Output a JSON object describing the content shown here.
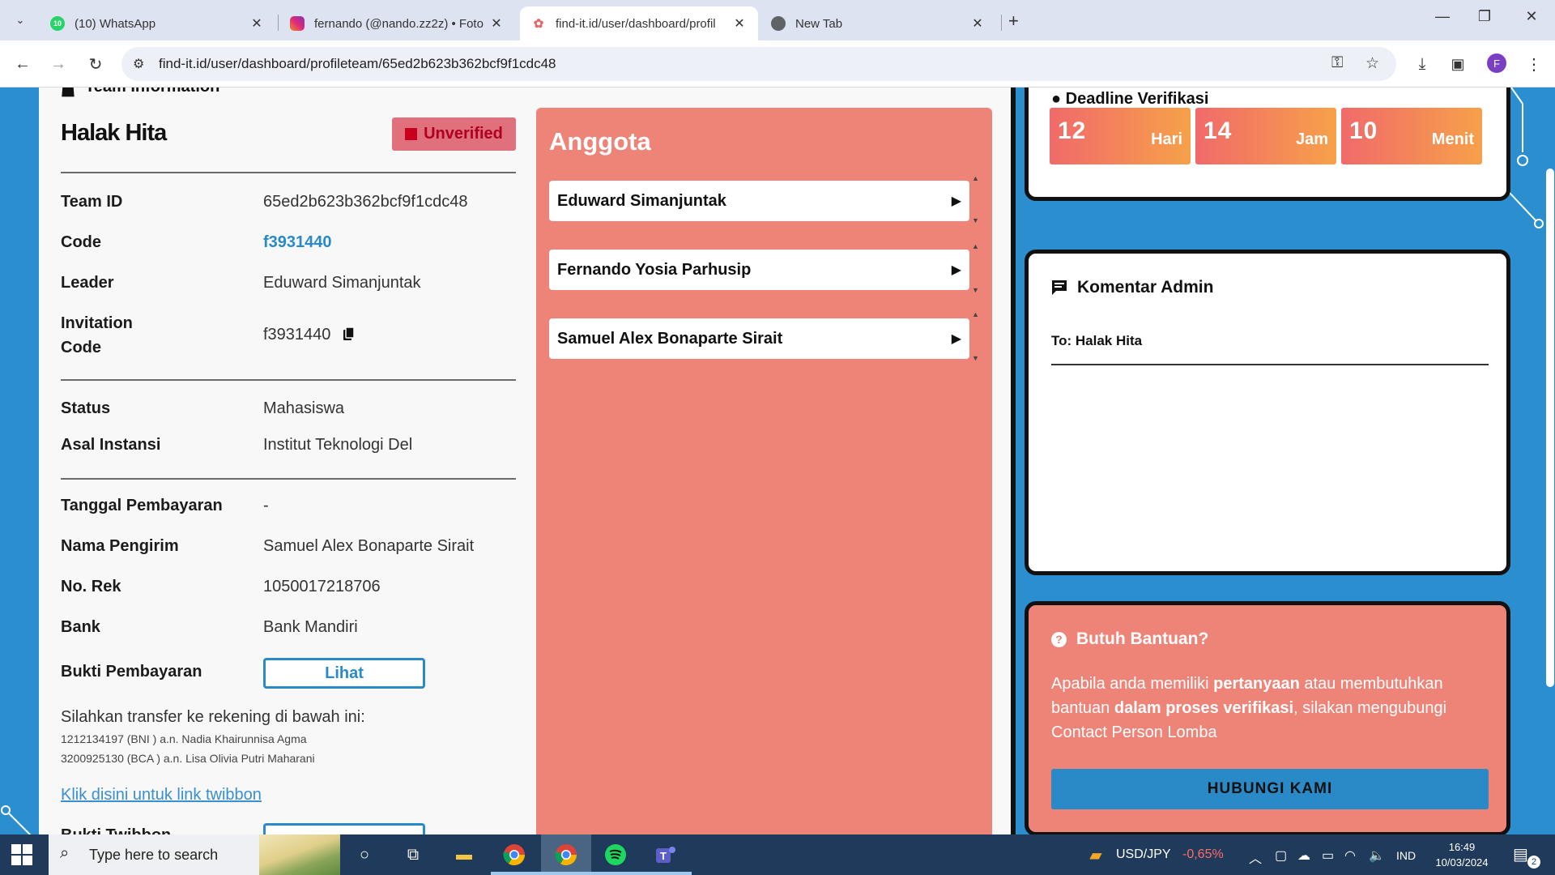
{
  "browser": {
    "tabs": [
      {
        "title": "(10) WhatsApp",
        "badge": "10"
      },
      {
        "title": "fernando (@nando.zz2z) • Foto"
      },
      {
        "title": "find-it.id/user/dashboard/profil"
      },
      {
        "title": "New Tab"
      }
    ],
    "url": "find-it.id/user/dashboard/profileteam/65ed2b623b362bcf9f1cdc48",
    "profile_initial": "F"
  },
  "team": {
    "section_title": "Team Information",
    "name": "Halak Hita",
    "status_badge": "Unverified",
    "fields": {
      "team_id_label": "Team ID",
      "team_id": "65ed2b623b362bcf9f1cdc48",
      "code_label": "Code",
      "code": "f3931440",
      "leader_label": "Leader",
      "leader": "Eduward Simanjuntak",
      "invitation_label_1": "Invitation",
      "invitation_label_2": "Code",
      "invitation_code": "f3931440",
      "status_label": "Status",
      "status": "Mahasiswa",
      "asal_label": "Asal Instansi",
      "asal": "Institut Teknologi Del",
      "tanggal_label": "Tanggal Pembayaran",
      "tanggal": "-",
      "pengirim_label": "Nama Pengirim",
      "pengirim": "Samuel Alex Bonaparte Sirait",
      "rek_label": "No. Rek",
      "rek": "1050017218706",
      "bank_label": "Bank",
      "bank": "Bank Mandiri",
      "bukti_label": "Bukti Pembayaran",
      "bukti_button": "Lihat",
      "bukti_twibbon_label": "Bukti Twibbon"
    },
    "transfer_text": "Silahkan transfer ke rekening di bawah ini:",
    "accounts": [
      "1212134197 (BNI ) a.n. Nadia Khairunnisa Agma",
      "3200925130 (BCA ) a.n. Lisa Olivia Putri Maharani"
    ],
    "twibbon_link": "Klik disini untuk link twibbon"
  },
  "anggota": {
    "title": "Anggota",
    "members": [
      "Eduward Simanjuntak",
      "Fernando Yosia Parhusip",
      "Samuel Alex Bonaparte Sirait"
    ]
  },
  "deadline": {
    "title": "Deadline Verifikasi",
    "boxes": [
      {
        "num": "12",
        "unit": "Hari"
      },
      {
        "num": "14",
        "unit": "Jam"
      },
      {
        "num": "10",
        "unit": "Menit"
      }
    ]
  },
  "komentar": {
    "title": "Komentar Admin",
    "to": "To: Halak Hita"
  },
  "bantuan": {
    "title": "Butuh Bantuan?",
    "text_1": "Apabila anda memiliki ",
    "bold_1": "pertanyaan",
    "text_2": " atau membutuhkan bantuan ",
    "bold_2": "dalam proses verifikasi",
    "text_3": ", silakan mengubungi Contact Person Lomba",
    "button": "HUBUNGI KAMI"
  },
  "taskbar": {
    "search_placeholder": "Type here to search",
    "ticker": "USD/JPY",
    "ticker_change": "-0,65%",
    "lang": "IND",
    "time": "16:49",
    "date": "10/03/2024",
    "notif_count": "2"
  },
  "colors": {
    "accent": "#2b8fcf",
    "salmon": "#ee8478",
    "unverified": "#c8001e"
  }
}
